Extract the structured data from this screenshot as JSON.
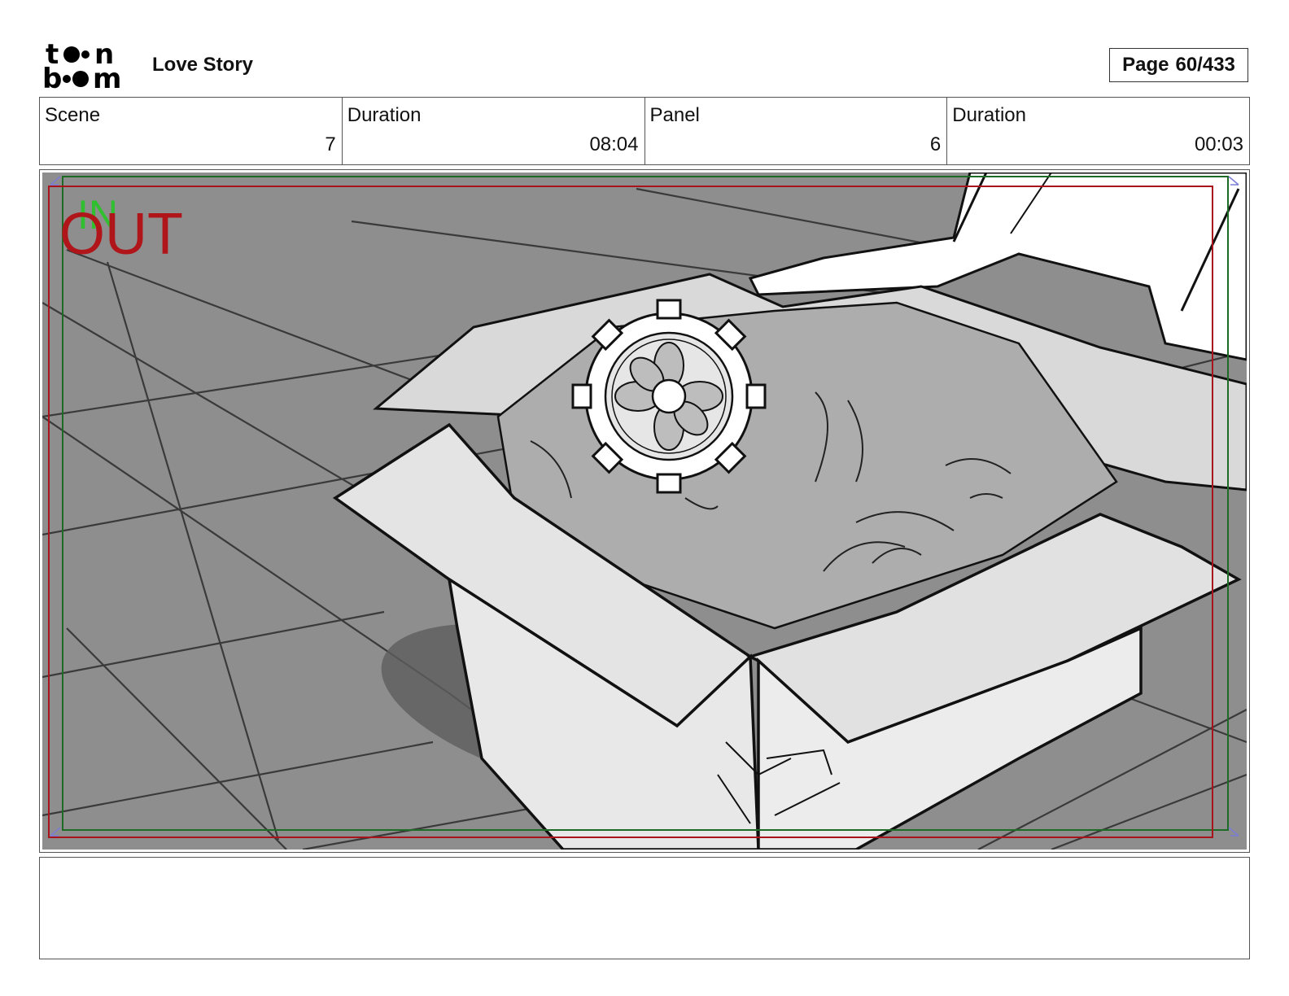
{
  "header": {
    "logo": "toon boom",
    "title": "Love Story",
    "page_label": "Page",
    "page_number": "60/433"
  },
  "info": [
    {
      "label": "Scene",
      "value": "7"
    },
    {
      "label": "Duration",
      "value": "08:04"
    },
    {
      "label": "Panel",
      "value": "6"
    },
    {
      "label": "Duration",
      "value": "00:03"
    }
  ],
  "panel": {
    "in_marker": "IN",
    "out_marker": "OUT",
    "colors": {
      "in": "#2fbf2f",
      "out": "#b0151a",
      "safe_green": "#1d6b24",
      "safe_red": "#a8141c"
    }
  },
  "notes": ""
}
